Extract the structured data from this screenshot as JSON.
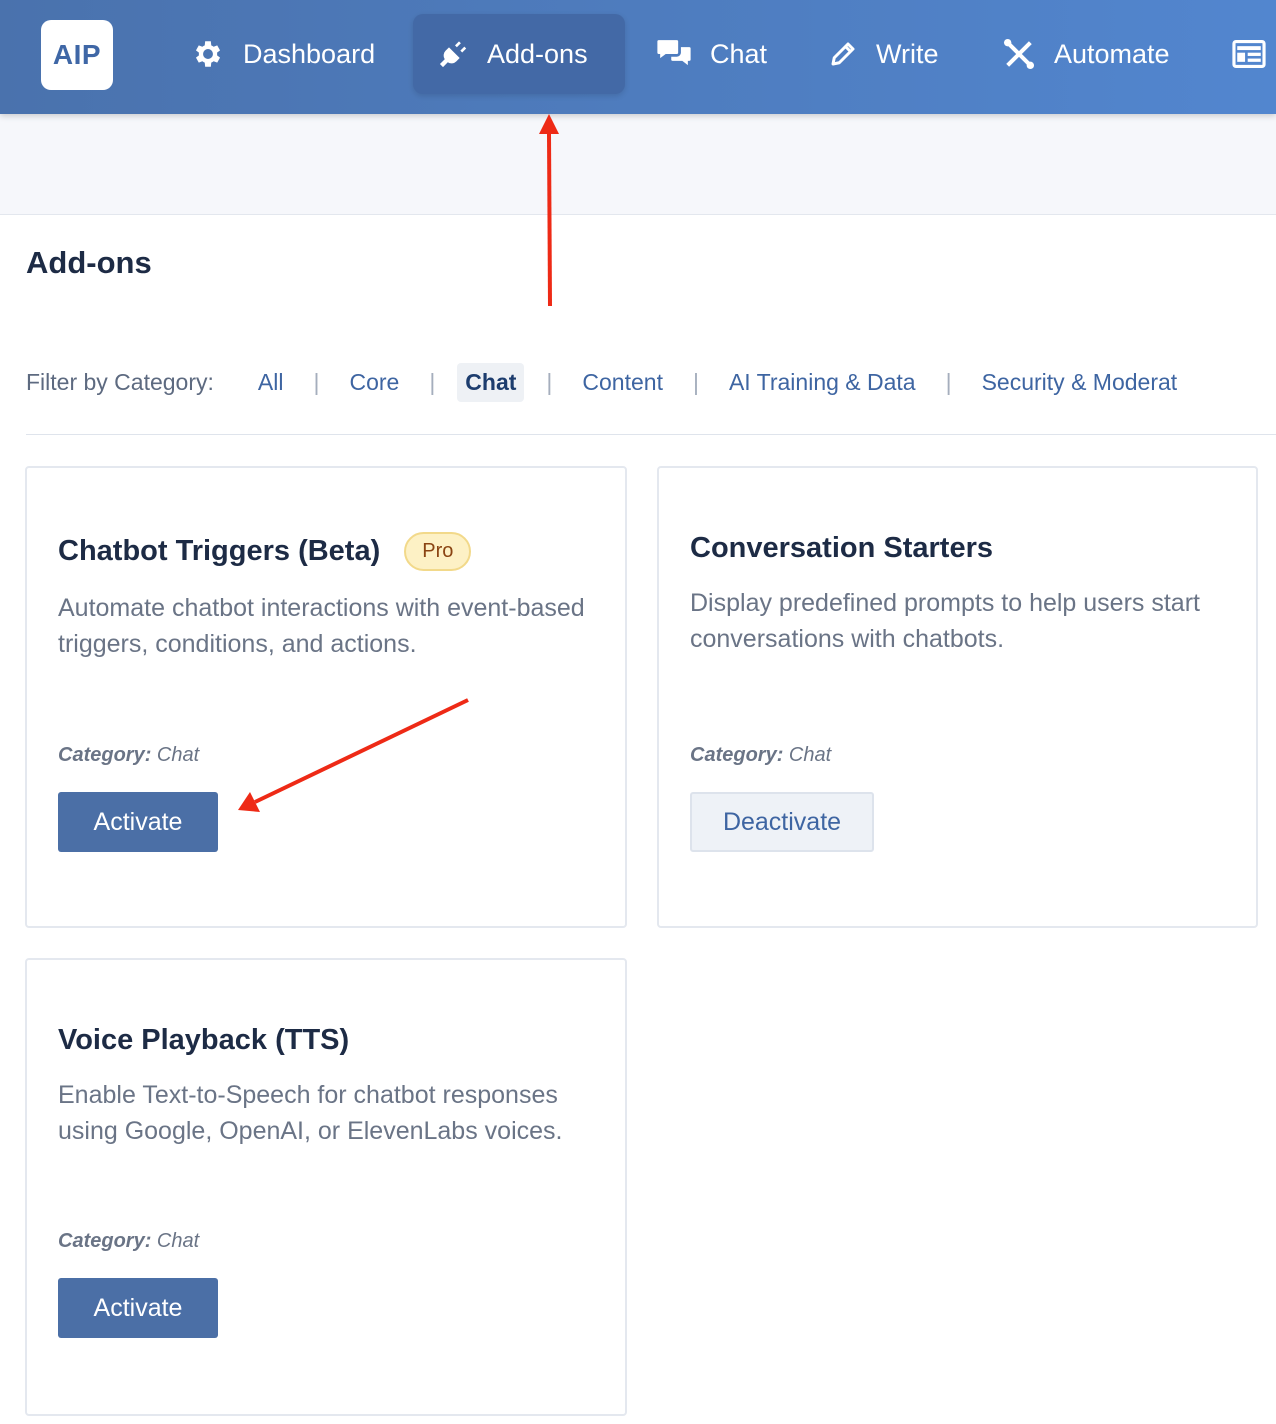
{
  "nav": {
    "logo": "AIP",
    "items": [
      {
        "label": "Dashboard",
        "icon": "gear-icon"
      },
      {
        "label": "Add-ons",
        "icon": "plug-icon",
        "active": true
      },
      {
        "label": "Chat",
        "icon": "chat-bubbles-icon"
      },
      {
        "label": "Write",
        "icon": "pencil-icon"
      },
      {
        "label": "Automate",
        "icon": "tools-icon"
      },
      {
        "label": "",
        "icon": "newspaper-icon"
      }
    ]
  },
  "page": {
    "title": "Add-ons"
  },
  "filter": {
    "label": "Filter by Category:",
    "separator": "|",
    "categories": [
      "All",
      "Core",
      "Chat",
      "Content",
      "AI Training & Data",
      "Security & Moderat"
    ],
    "active": "Chat"
  },
  "cards": [
    {
      "title": "Chatbot Triggers (Beta)",
      "badge": "Pro",
      "description": "Automate chatbot interactions with event-based triggers, conditions, and actions.",
      "category_label": "Category:",
      "category": "Chat",
      "button": "Activate"
    },
    {
      "title": "Conversation Starters",
      "description": "Display predefined prompts to help users start conversations with chatbots.",
      "category_label": "Category:",
      "category": "Chat",
      "button": "Deactivate"
    },
    {
      "title": "Voice Playback (TTS)",
      "description": "Enable Text-to-Speech for chatbot responses using Google, OpenAI, or ElevenLabs voices.",
      "category_label": "Category:",
      "category": "Chat",
      "button": "Activate"
    }
  ],
  "colors": {
    "nav_gradient_start": "#4a72ad",
    "nav_gradient_end": "#5286cf",
    "primary_button": "#4b6fa6",
    "annotation_arrow": "#ee2a16",
    "pro_badge_bg": "#fdf1c5"
  }
}
